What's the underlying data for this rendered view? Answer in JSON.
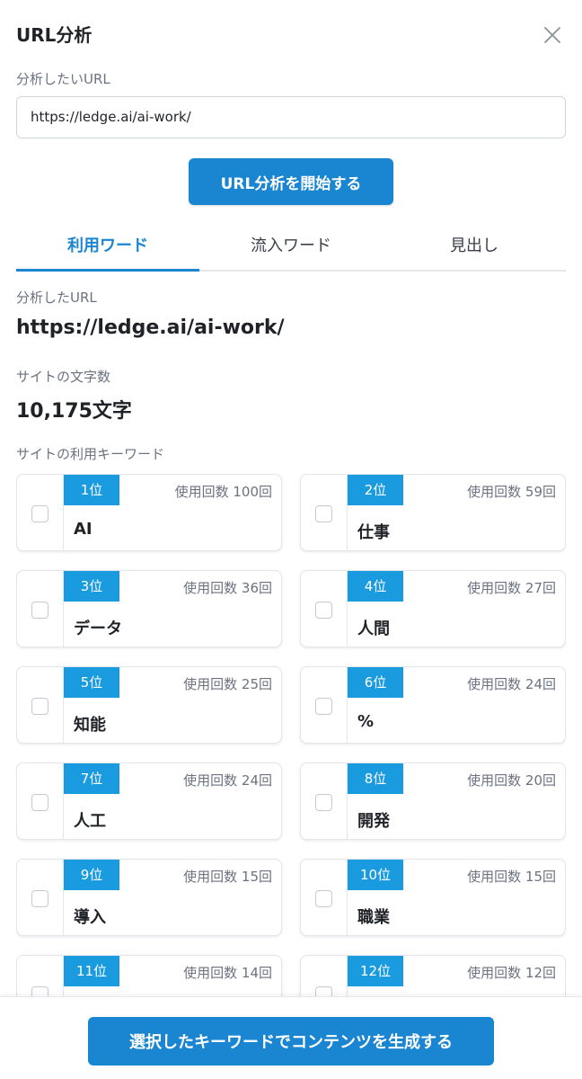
{
  "header": {
    "title": "URL分析"
  },
  "form": {
    "url_label": "分析したいURL",
    "url_value": "https://ledge.ai/ai-work/",
    "start_button": "URL分析を開始する"
  },
  "tabs": [
    {
      "label": "利用ワード",
      "active": true
    },
    {
      "label": "流入ワード",
      "active": false
    },
    {
      "label": "見出し",
      "active": false
    }
  ],
  "result": {
    "analyzed_url_label": "分析したURL",
    "analyzed_url": "https://ledge.ai/ai-work/",
    "char_count_label": "サイトの文字数",
    "char_count": "10,175文字",
    "keywords_label": "サイトの利用キーワード"
  },
  "keywords": [
    {
      "rank": "1位",
      "count": "使用回数 100回",
      "word": "AI"
    },
    {
      "rank": "2位",
      "count": "使用回数 59回",
      "word": "仕事"
    },
    {
      "rank": "3位",
      "count": "使用回数 36回",
      "word": "データ"
    },
    {
      "rank": "4位",
      "count": "使用回数 27回",
      "word": "人間"
    },
    {
      "rank": "5位",
      "count": "使用回数 25回",
      "word": "知能"
    },
    {
      "rank": "6位",
      "count": "使用回数 24回",
      "word": "%"
    },
    {
      "rank": "7位",
      "count": "使用回数 24回",
      "word": "人工"
    },
    {
      "rank": "8位",
      "count": "使用回数 20回",
      "word": "開発"
    },
    {
      "rank": "9位",
      "count": "使用回数 15回",
      "word": "導入"
    },
    {
      "rank": "10位",
      "count": "使用回数 15回",
      "word": "職業"
    },
    {
      "rank": "11位",
      "count": "使用回数 14回",
      "word": ""
    },
    {
      "rank": "12位",
      "count": "使用回数 12回",
      "word": ""
    }
  ],
  "footer": {
    "generate_button": "選択したキーワードでコンテンツを生成する"
  },
  "colors": {
    "accent": "#1a85d1",
    "rank_badge": "#1a9be0"
  }
}
